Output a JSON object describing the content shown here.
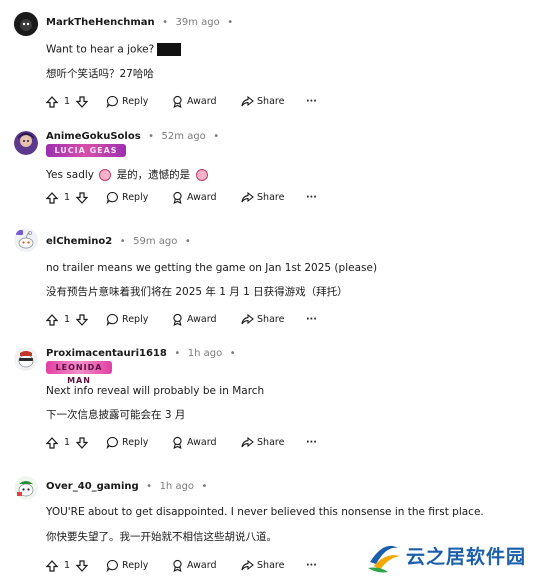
{
  "comments": [
    {
      "username": "MarkTheHenchman",
      "time": "39m ago",
      "flair": "",
      "lines": [
        "Want to hear a joke?",
        "想听个笑话吗？27哈哈"
      ],
      "votes": "1"
    },
    {
      "username": "AnimeGokuSolos",
      "time": "52m ago",
      "flair": "LUCIA GEAS",
      "lines": [
        "Yes sadly",
        "是的，遗憾的是"
      ],
      "votes": "1"
    },
    {
      "username": "elChemino2",
      "time": "59m ago",
      "flair": "",
      "lines": [
        "no trailer means we getting the game on Jan 1st 2025 (please)",
        "没有预告片意味着我们将在 2025 年 1 月 1 日获得游戏（拜托）"
      ],
      "votes": "1"
    },
    {
      "username": "Proximacentauri1618",
      "time": "1h ago",
      "flair": "LEONIDA MAN",
      "lines": [
        "Next info reveal will probably be in March",
        "下一次信息披露可能会在 3 月"
      ],
      "votes": "1"
    },
    {
      "username": "Over_40_gaming",
      "time": "1h ago",
      "flair": "",
      "lines": [
        "YOU'RE about to get disappointed. I never believed this nonsense in the first place.",
        "你快要失望了。我一开始就不相信这些胡说八道。"
      ],
      "votes": "1"
    }
  ],
  "actions": {
    "reply": "Reply",
    "award": "Award",
    "share": "Share",
    "more": "···"
  },
  "watermark": {
    "text": "云之居软件园"
  },
  "colors": {
    "text": "#1a1a1b",
    "muted": "#7c7c7c",
    "watermark": "#1b5faa"
  }
}
